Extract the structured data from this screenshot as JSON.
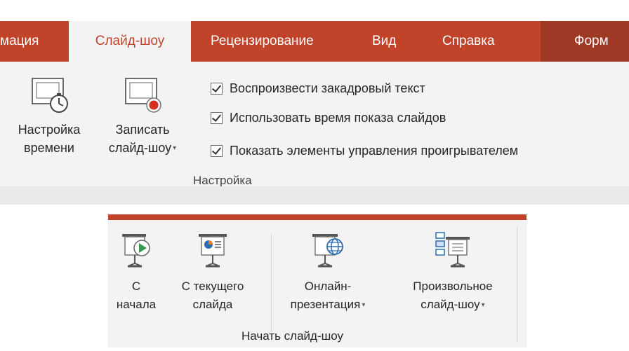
{
  "tabs": [
    {
      "label": "мация"
    },
    {
      "label": "Слайд-шоу",
      "active": true
    },
    {
      "label": "Рецензирование"
    },
    {
      "label": "Вид"
    },
    {
      "label": "Справка"
    },
    {
      "label": "Форм"
    }
  ],
  "setup_group": {
    "rehearse": {
      "line1": "Настройка",
      "line2": "времени",
      "icon": "rehearse-timings-icon"
    },
    "record": {
      "line1": "Записать",
      "line2": "слайд-шоу",
      "icon": "record-slideshow-icon"
    },
    "checkboxes": [
      {
        "label": "Воспроизвести закадровый текст",
        "checked": true
      },
      {
        "label": "Использовать время показа слайдов",
        "checked": true
      },
      {
        "label": "Показать элементы управления проигрывателем",
        "checked": true
      }
    ],
    "group_label": "Настройка"
  },
  "start_group": {
    "from_beginning": {
      "line1": "С",
      "line2": "начала",
      "icon": "play-from-start-icon"
    },
    "from_current": {
      "line1": "С текущего",
      "line2": "слайда",
      "icon": "from-current-slide-icon"
    },
    "online": {
      "line1": "Онлайн-",
      "line2": "презентация",
      "icon": "online-present-icon"
    },
    "custom": {
      "line1": "Произвольное",
      "line2": "слайд-шоу",
      "icon": "custom-slideshow-icon"
    },
    "group_label": "Начать слайд-шоу"
  },
  "colors": {
    "accent": "#c1432a",
    "ribbon_bg": "#f3f3f3"
  }
}
